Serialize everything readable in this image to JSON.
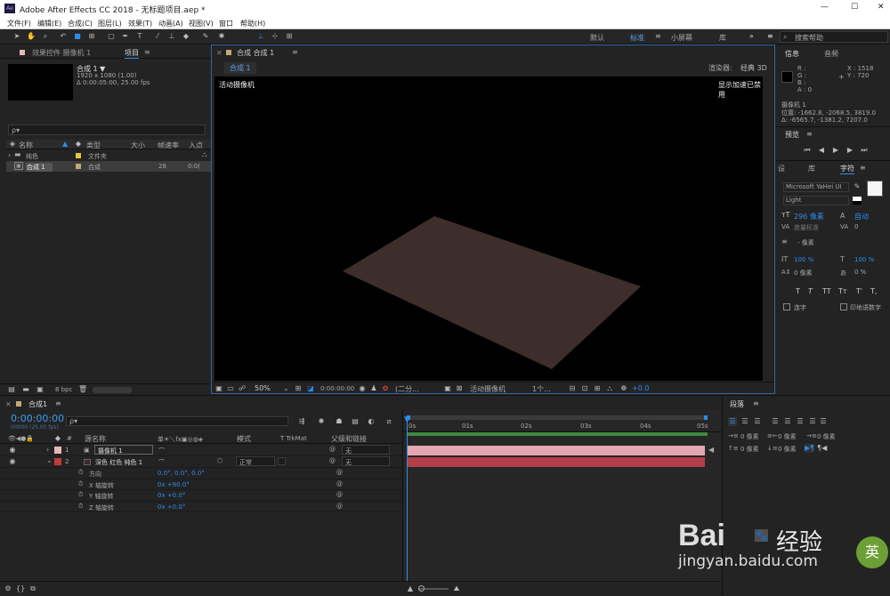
{
  "window": {
    "title": "Adobe After Effects CC 2018 - 无标题项目.aep *",
    "app_badge": "Ae",
    "minimize": "—",
    "maximize": "☐",
    "close": "✕"
  },
  "menu": [
    "文件(F)",
    "编辑(E)",
    "合成(C)",
    "图层(L)",
    "效果(T)",
    "动画(A)",
    "视图(V)",
    "窗口",
    "帮助(H)"
  ],
  "workspace": {
    "default": "默认",
    "standard": "标准",
    "small": "小屏幕",
    "library": "库",
    "more": "»",
    "search_placeholder": "搜索帮助"
  },
  "project_panel": {
    "tab_effects": "效果控件 摄像机 1",
    "tab_project": "项目",
    "menu_icon": "≡",
    "comp_name": "合成 1 ▼",
    "comp_size": "1920 x 1080 (1.00)",
    "comp_duration": "Δ 0:00:05:00, 25.00 fps",
    "search_placeholder": "ρ▾",
    "columns": [
      "名称",
      "类型",
      "大小",
      "帧速率",
      "入点"
    ],
    "rows": [
      {
        "name": "纯色",
        "type": "文件夹",
        "size": "",
        "fps": "",
        "in": ""
      },
      {
        "name": "合成 1",
        "type": "合成",
        "size": "",
        "fps": "28",
        "in": "0:0("
      }
    ],
    "bpc": "8 bpc"
  },
  "viewer": {
    "tab": "合成 合成 1",
    "menu_icon": "≡",
    "subtab": "合成 1",
    "renderer_label": "渲染器:",
    "renderer": "经典 3D",
    "active_camera": "活动摄像机",
    "accel": "显示加速已禁用",
    "zoom": "50%",
    "timecode": "0:00:00:00",
    "resolution": "(二分...",
    "view": "活动摄像机",
    "views": "1个...",
    "exposure": "+0.0"
  },
  "info_panel": {
    "tab_info": "信息",
    "tab_audio": "音频",
    "menu_icon": "≡",
    "r": "R :",
    "g": "G :",
    "b": "B :",
    "a": "A : 0",
    "x": "X : 1518",
    "y": "Y : 720",
    "camera": "摄像机 1",
    "position": "位置: -1662.8, -2068.5, 3819.0",
    "delta": "Δ: -6565.7, -1381.2, 7207.0"
  },
  "preview_panel": {
    "tab": "预览",
    "menu_icon": "≡"
  },
  "char_panel": {
    "tab_effects": "设",
    "tab_lib": "库",
    "tab_char": "字符",
    "menu_icon": "≡",
    "font": "Microsoft YaHei UI",
    "style": "Light",
    "size": "296 像素",
    "leading": "自动",
    "tracking_label": "度量标准",
    "tracking": "0",
    "stroke": "- 像素",
    "vscale": "100 %",
    "hscale": "100 %",
    "baseline": "0 像素",
    "tsume": "0 %",
    "styles": [
      "T",
      "T",
      "TT",
      "Tт",
      "T'",
      "T,"
    ],
    "ligature": "连字",
    "hindi": "印地语数字"
  },
  "timeline": {
    "tab": "合成1",
    "menu_icon": "≡",
    "timecode": "0:00:00:00",
    "timecode_sub": "00000 (25.00 fps)",
    "search_placeholder": "ρ▾",
    "columns": [
      "#",
      "源名称",
      "单☀＼fx▣◎◍◈",
      "模式",
      "T TrkMat",
      "父级和链接"
    ],
    "ruler": [
      "0s",
      "01s",
      "02s",
      "03s",
      "04s",
      "05s"
    ],
    "layers": [
      {
        "num": "1",
        "name": "摄像机 1",
        "color": "#e8b7b7",
        "parent": "无"
      },
      {
        "num": "2",
        "name": "深色 红色 纯色 1",
        "color": "#c23b3b",
        "mode": "正常",
        "parent": "无"
      }
    ],
    "props": [
      {
        "name": "方向",
        "value": "0.0°, 0.0°, 0.0°"
      },
      {
        "name": "X 轴旋转",
        "value": "0x +90.0°"
      },
      {
        "name": "Y 轴旋转",
        "value": "0x +0.0°"
      },
      {
        "name": "Z 轴旋转",
        "value": "0x +0.0°"
      }
    ]
  },
  "para_panel": {
    "tab": "段落",
    "menu_icon": "≡",
    "indent": [
      "0 像素",
      "0 像素",
      "0 像素",
      "0 像素",
      "0 像素"
    ]
  },
  "watermark": {
    "brand": "Bai",
    "brand2": "经验",
    "url": "jingyan.baidu.com",
    "badge": "英"
  }
}
